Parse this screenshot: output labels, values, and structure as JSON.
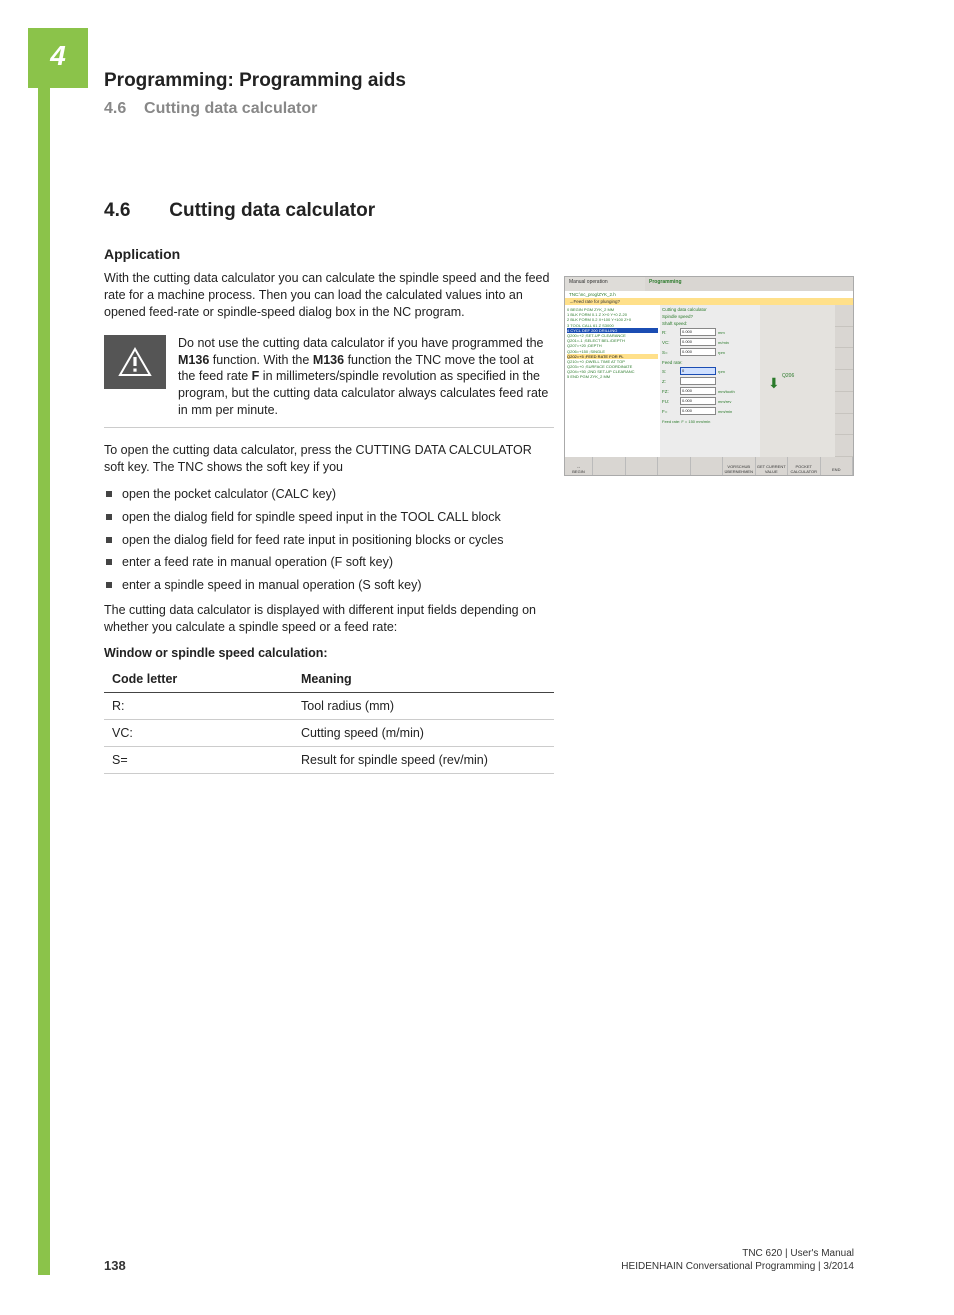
{
  "chapter_number": "4",
  "header": {
    "chapter_title": "Programming: Programming aids",
    "section_ref": "4.6",
    "section_name_top": "Cutting data calculator"
  },
  "section": {
    "number": "4.6",
    "title": "Cutting data calculator"
  },
  "application": {
    "heading": "Application",
    "intro": "With the cutting data calculator you can calculate the spindle speed and the feed rate for a machine process. Then you can load the calculated values into an opened feed-rate or spindle-speed dialog box in the NC program.",
    "warning_pre": "Do not use the cutting data calculator if you have programmed the ",
    "warning_bold1": "M136",
    "warning_mid1": " function. With the ",
    "warning_bold2": "M136",
    "warning_mid2": " function the TNC move the tool at the feed rate ",
    "warning_bold3": "F",
    "warning_post": " in millimeters/spindle revolution as specified in the program, but the cutting data calculator always calculates feed rate in mm per minute.",
    "open_text": "To open the cutting data calculator, press the CUTTING DATA CALCULATOR soft key. The TNC shows the soft key if you",
    "bullets": [
      "open the pocket calculator (CALC key)",
      "open the dialog field for spindle speed input in the TOOL CALL block",
      "open the dialog field for feed rate input in positioning blocks or cycles",
      "enter a feed rate in manual operation (F soft key)",
      "enter a spindle speed in manual operation (S soft key)"
    ],
    "display_note": "The cutting data calculator is displayed with different input fields depending on whether you calculate a spindle speed or a feed rate:"
  },
  "table": {
    "caption": "Window or spindle speed calculation:",
    "headers": [
      "Code letter",
      "Meaning"
    ],
    "rows": [
      [
        "R:",
        "Tool radius (mm)"
      ],
      [
        "VC:",
        "Cutting speed (m/min)"
      ],
      [
        "S=",
        "Result for spindle speed (rev/min)"
      ]
    ]
  },
  "screenshot": {
    "mode_left": "Manual operation",
    "mode_right": "Programming",
    "path": "TNC:\\nc_prog\\ZYK_2.h",
    "question": "→Feed rate for plunging?",
    "program_lines": [
      "0 BEGIN PGM ZYK_2 MM",
      "1 BLK FORM 0.1 Z X+0 Y+0 Z-20",
      "2 BLK FORM 0.2 X+100 Y+100 Z+0",
      "3 TOOL CALL 61 Z S3000",
      "4 CYCL DEF 200 DRILLING",
      "  Q200=+2  ;SET-UP CLEARANCE",
      "  Q201=-1  ;SELECT BEL./DEPTH",
      "  Q207=+20 ;DEPTH",
      "  Q206=+150 ;SINGLE",
      "  Q202=+5  ;FEED RATE FOR PL",
      "  Q210=+0  ;DWELL TIME AT TOP",
      "  Q203=+0  ;SURFACE COORDINATE",
      "  Q204=+50 ;2ND SET-UP CLEARANC",
      "5 END PGM ZYK_2 MM"
    ],
    "calc_title": "Cutting data calculator",
    "calc_subtitle": "Spindle speed?",
    "calc_section1": "Shaft speed:",
    "fields": [
      {
        "label": "R:",
        "value": "0.000",
        "unit": "mm"
      },
      {
        "label": "VC:",
        "value": "0.000",
        "unit": "m/min"
      },
      {
        "label": "S=",
        "value": "0.000",
        "unit": "rpm"
      }
    ],
    "calc_section2": "Feed rate:",
    "fields2": [
      {
        "label": "S:",
        "value": "0",
        "unit": "rpm",
        "active": true
      },
      {
        "label": "Z:",
        "value": "",
        "unit": ""
      },
      {
        "label": "FZ:",
        "value": "0.000",
        "unit": "mm/tooth"
      },
      {
        "label": "FU:",
        "value": "0.000",
        "unit": "mm/rev"
      },
      {
        "label": "F=",
        "value": "0.000",
        "unit": "mm/min"
      }
    ],
    "feed_note": "Feed rate: F = 150 mm/min",
    "arrow_label": "Q206",
    "softkeys": [
      "",
      "",
      "",
      "",
      "VORSCHUB ÜBERNEHMEN",
      "GET CURRENT VALUE",
      "POCKET CALCULATOR",
      "END"
    ],
    "begin_block": "BEGIN"
  },
  "footer": {
    "page": "138",
    "line1": "TNC 620 | User's Manual",
    "line2": "HEIDENHAIN Conversational Programming | 3/2014"
  }
}
